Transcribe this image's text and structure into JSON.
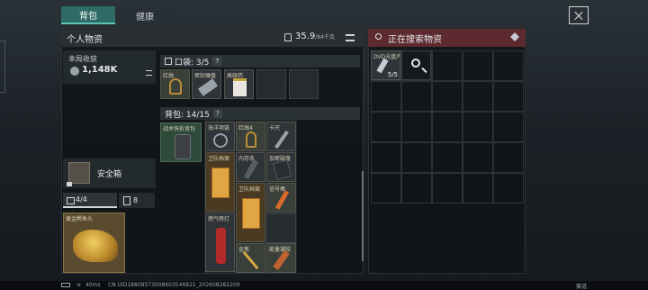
{
  "tabs": [
    {
      "label": "背包"
    },
    {
      "label": "健康"
    }
  ],
  "personal": {
    "title": "个人物资",
    "weight": "35.9",
    "weight_max": "/84千克"
  },
  "earnings": {
    "label": "本局收获",
    "value": "1,148K"
  },
  "pocket": {
    "label": "口袋: 3/5",
    "items": [
      {
        "name": "红烛"
      },
      {
        "name": "密封硬盘"
      },
      {
        "name": "高级药"
      }
    ]
  },
  "backpack": {
    "label": "背包: 14/15",
    "main_item": "战术快拆背包",
    "items": [
      {
        "name": "海洋项链"
      },
      {
        "name": "红烛4"
      },
      {
        "name": "卡尺"
      },
      {
        "name": "卫队档案"
      },
      {
        "name": "内存条"
      },
      {
        "name": "加密磁盘"
      },
      {
        "name": "卫队档案"
      },
      {
        "name": "信号棒"
      },
      {
        "name": "燃气喷灯"
      },
      {
        "name": "金笔"
      },
      {
        "name": "能量凝胶"
      }
    ]
  },
  "safebox": {
    "label": "安全箱"
  },
  "equip_tabs": [
    {
      "label": "4/4"
    },
    {
      "label": "8"
    }
  ],
  "featured": {
    "name": "黄金鳄鱼头"
  },
  "search": {
    "title": "正在搜索物资",
    "item_name": "DVD光盘片",
    "item_count": "5/5"
  },
  "status": {
    "ping": "40ms",
    "uid": "CN UID18808573008603546821_202608282209",
    "right": "赛道"
  },
  "colors": {
    "accent": "#2f6b66",
    "search_header": "#5c2a2f",
    "gold": "#c9a23a"
  }
}
